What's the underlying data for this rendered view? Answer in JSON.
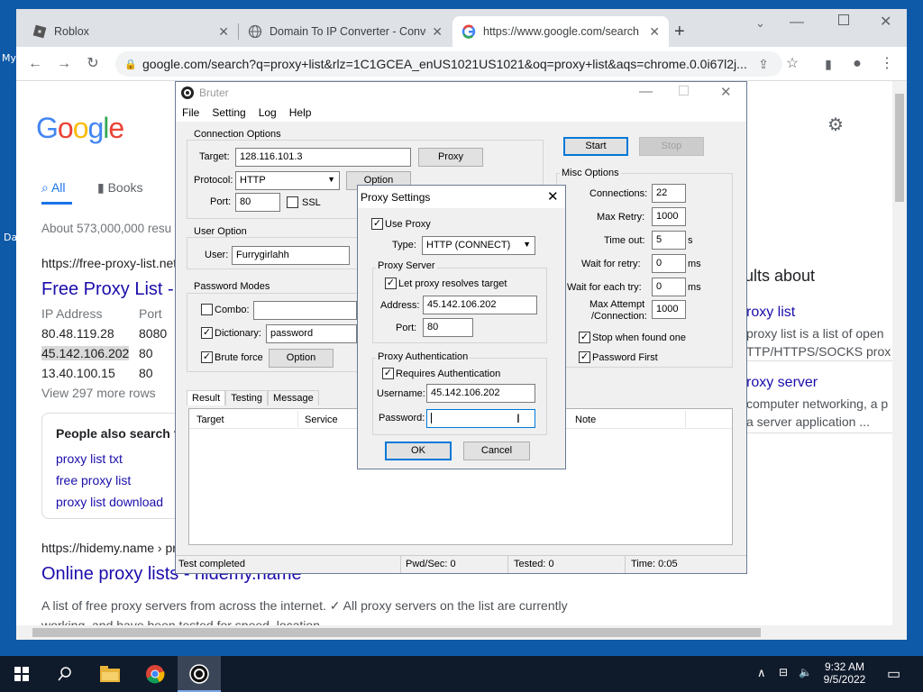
{
  "desktop": {
    "icon_label_1": "My",
    "icon_label_2": "Da"
  },
  "browser": {
    "tabs": [
      {
        "title": "Roblox"
      },
      {
        "title": "Domain To IP Converter - Conve"
      },
      {
        "title": "https://www.google.com/search"
      }
    ],
    "new_tab": "+",
    "address": "google.com/search?q=proxy+list&rlz=1C1GCEA_enUS1021US1021&oq=proxy+list&aqs=chrome.0.0i67l2j..."
  },
  "google": {
    "logo": "Google",
    "tabs": [
      "All",
      "Books"
    ],
    "results_count": "About 573,000,000 resu",
    "result1": {
      "url": "https://free-proxy-list.net",
      "title": "Free Proxy List -",
      "col1": "IP Address",
      "col2": "Port",
      "rows": [
        {
          "ip": "80.48.119.28",
          "port": "8080"
        },
        {
          "ip": "45.142.106.202",
          "port": "80"
        },
        {
          "ip": "13.40.100.15",
          "port": "80"
        }
      ],
      "more": "View 297 more rows"
    },
    "people_also": {
      "heading": "People also search fo",
      "items": [
        "proxy list txt",
        "free proxy list",
        "proxy list download"
      ]
    },
    "result2": {
      "url": "https://hidemy.name › pr",
      "title": "Online proxy lists - hidemy.name",
      "snippet1": "A list of free proxy servers from across the internet. ✓ All proxy servers on the list are currently",
      "snippet2": "working, and have been tested for speed, location, ..."
    },
    "side": {
      "heading": "ults about",
      "item1_title": "roxy list",
      "item1_line1": "proxy list is a list of open",
      "item1_line2": "TTP/HTTPS/SOCKS prox",
      "item2_title": "roxy server",
      "item2_line1": "computer networking, a p",
      "item2_line2": "a server application ..."
    }
  },
  "bruter": {
    "title": "Bruter",
    "menu": [
      "File",
      "Setting",
      "Log",
      "Help"
    ],
    "connection": {
      "group": "Connection Options",
      "target_label": "Target:",
      "target": "128.116.101.3",
      "proxy_button": "Proxy",
      "protocol_label": "Protocol:",
      "protocol": "HTTP",
      "option_button": "Option",
      "port_label": "Port:",
      "port": "80",
      "ssl": "SSL"
    },
    "user": {
      "group": "User Option",
      "label": "User:",
      "value": "Furrygirlahh"
    },
    "password": {
      "group": "Password Modes",
      "combo": "Combo:",
      "dictionary": "Dictionary:",
      "dictionary_value": "password",
      "brute": "Brute force",
      "option_button": "Option"
    },
    "start": "Start",
    "stop": "Stop",
    "misc": {
      "group": "Misc Options",
      "connections_label": "Connections:",
      "connections": "22",
      "max_retry_label": "Max Retry:",
      "max_retry": "1000",
      "timeout_label": "Time out:",
      "timeout": "5",
      "timeout_unit": "s",
      "wait_retry_label": "Wait for retry:",
      "wait_retry": "0",
      "wait_retry_unit": "ms",
      "wait_try_label": "Wait for each try:",
      "wait_try": "0",
      "wait_try_unit": "ms",
      "max_attempt_label1": "Max Attempt",
      "max_attempt_label2": "/Connection:",
      "max_attempt": "1000",
      "stop_found": "Stop when found one",
      "password_first": "Password First"
    },
    "result_tabs": [
      "Result",
      "Testing",
      "Message"
    ],
    "columns": [
      "Target",
      "Service",
      "Note"
    ],
    "status": {
      "text": "Test completed",
      "pwd": "Pwd/Sec: 0",
      "tested": "Tested: 0",
      "time": "Time: 0:05"
    }
  },
  "proxy": {
    "title": "Proxy Settings",
    "use_proxy": "Use Proxy",
    "type_label": "Type:",
    "type": "HTTP (CONNECT)",
    "server_group": "Proxy Server",
    "resolves": "Let proxy resolves target",
    "address_label": "Address:",
    "address": "45.142.106.202",
    "port_label": "Port:",
    "port": "80",
    "auth_group": "Proxy Authentication",
    "requires": "Requires Authentication",
    "username_label": "Username:",
    "username": "45.142.106.202",
    "password_label": "Password:",
    "password": "",
    "ok": "OK",
    "cancel": "Cancel"
  },
  "taskbar": {
    "time": "9:32 AM",
    "date": "9/5/2022"
  }
}
